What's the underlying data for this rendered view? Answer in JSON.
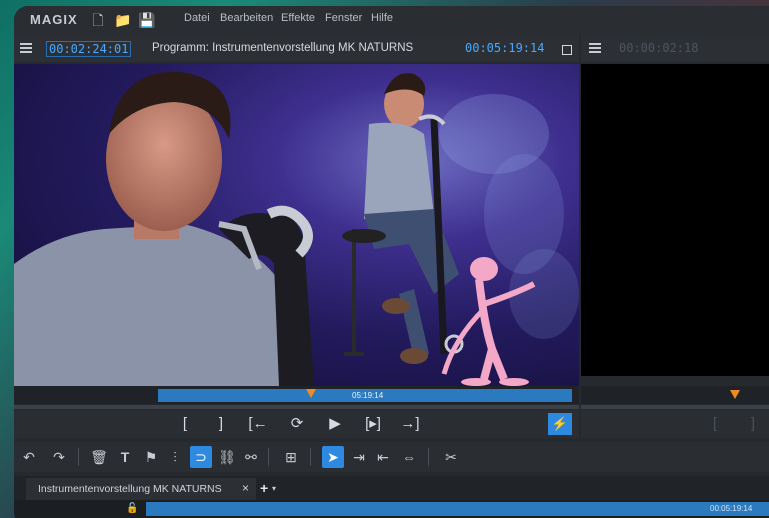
{
  "app": {
    "logo": "MAGIX"
  },
  "menu": [
    "Datei",
    "Bearbeiten",
    "Effekte",
    "Fenster",
    "Hilfe"
  ],
  "program_monitor": {
    "timecode_left": "00:02:24:01",
    "title": "Programm: Instrumentenvorstellung MK NATURNS",
    "timecode_right": "00:05:19:14",
    "range_label": "05:19:14"
  },
  "source_monitor": {
    "timecode": "00:00:02:18"
  },
  "transport": {
    "set_in": "[",
    "set_out": "]",
    "prev_marker": "[←",
    "loop": "⟳",
    "play": "▶",
    "play_range": "[▸]",
    "next_marker": "→]",
    "flash": "⚡"
  },
  "source_transport": {
    "in": "[",
    "out": "]"
  },
  "toolbar": {
    "undo": "↶",
    "redo": "↷",
    "delete": "🗑",
    "text": "T",
    "marker": "⚑",
    "split": "⫶",
    "loop": "⊃",
    "link": "⛓",
    "unlink": "⚯",
    "insert": "⊞",
    "pointer": "➤",
    "range_tool": "⇥",
    "trim_tool": "⇤",
    "stretch": "⇔",
    "effects": "✂"
  },
  "tabs": {
    "project": "Instrumentenvorstellung MK NATURNS",
    "close": "×",
    "add": "+",
    "dropdown": "▾"
  },
  "timeline": {
    "end_time": "00:05:19:14",
    "lock": "🔓"
  },
  "colors": {
    "accent": "#2e8ae0",
    "timecode": "#4aa8ff",
    "marker": "#f08b22"
  }
}
